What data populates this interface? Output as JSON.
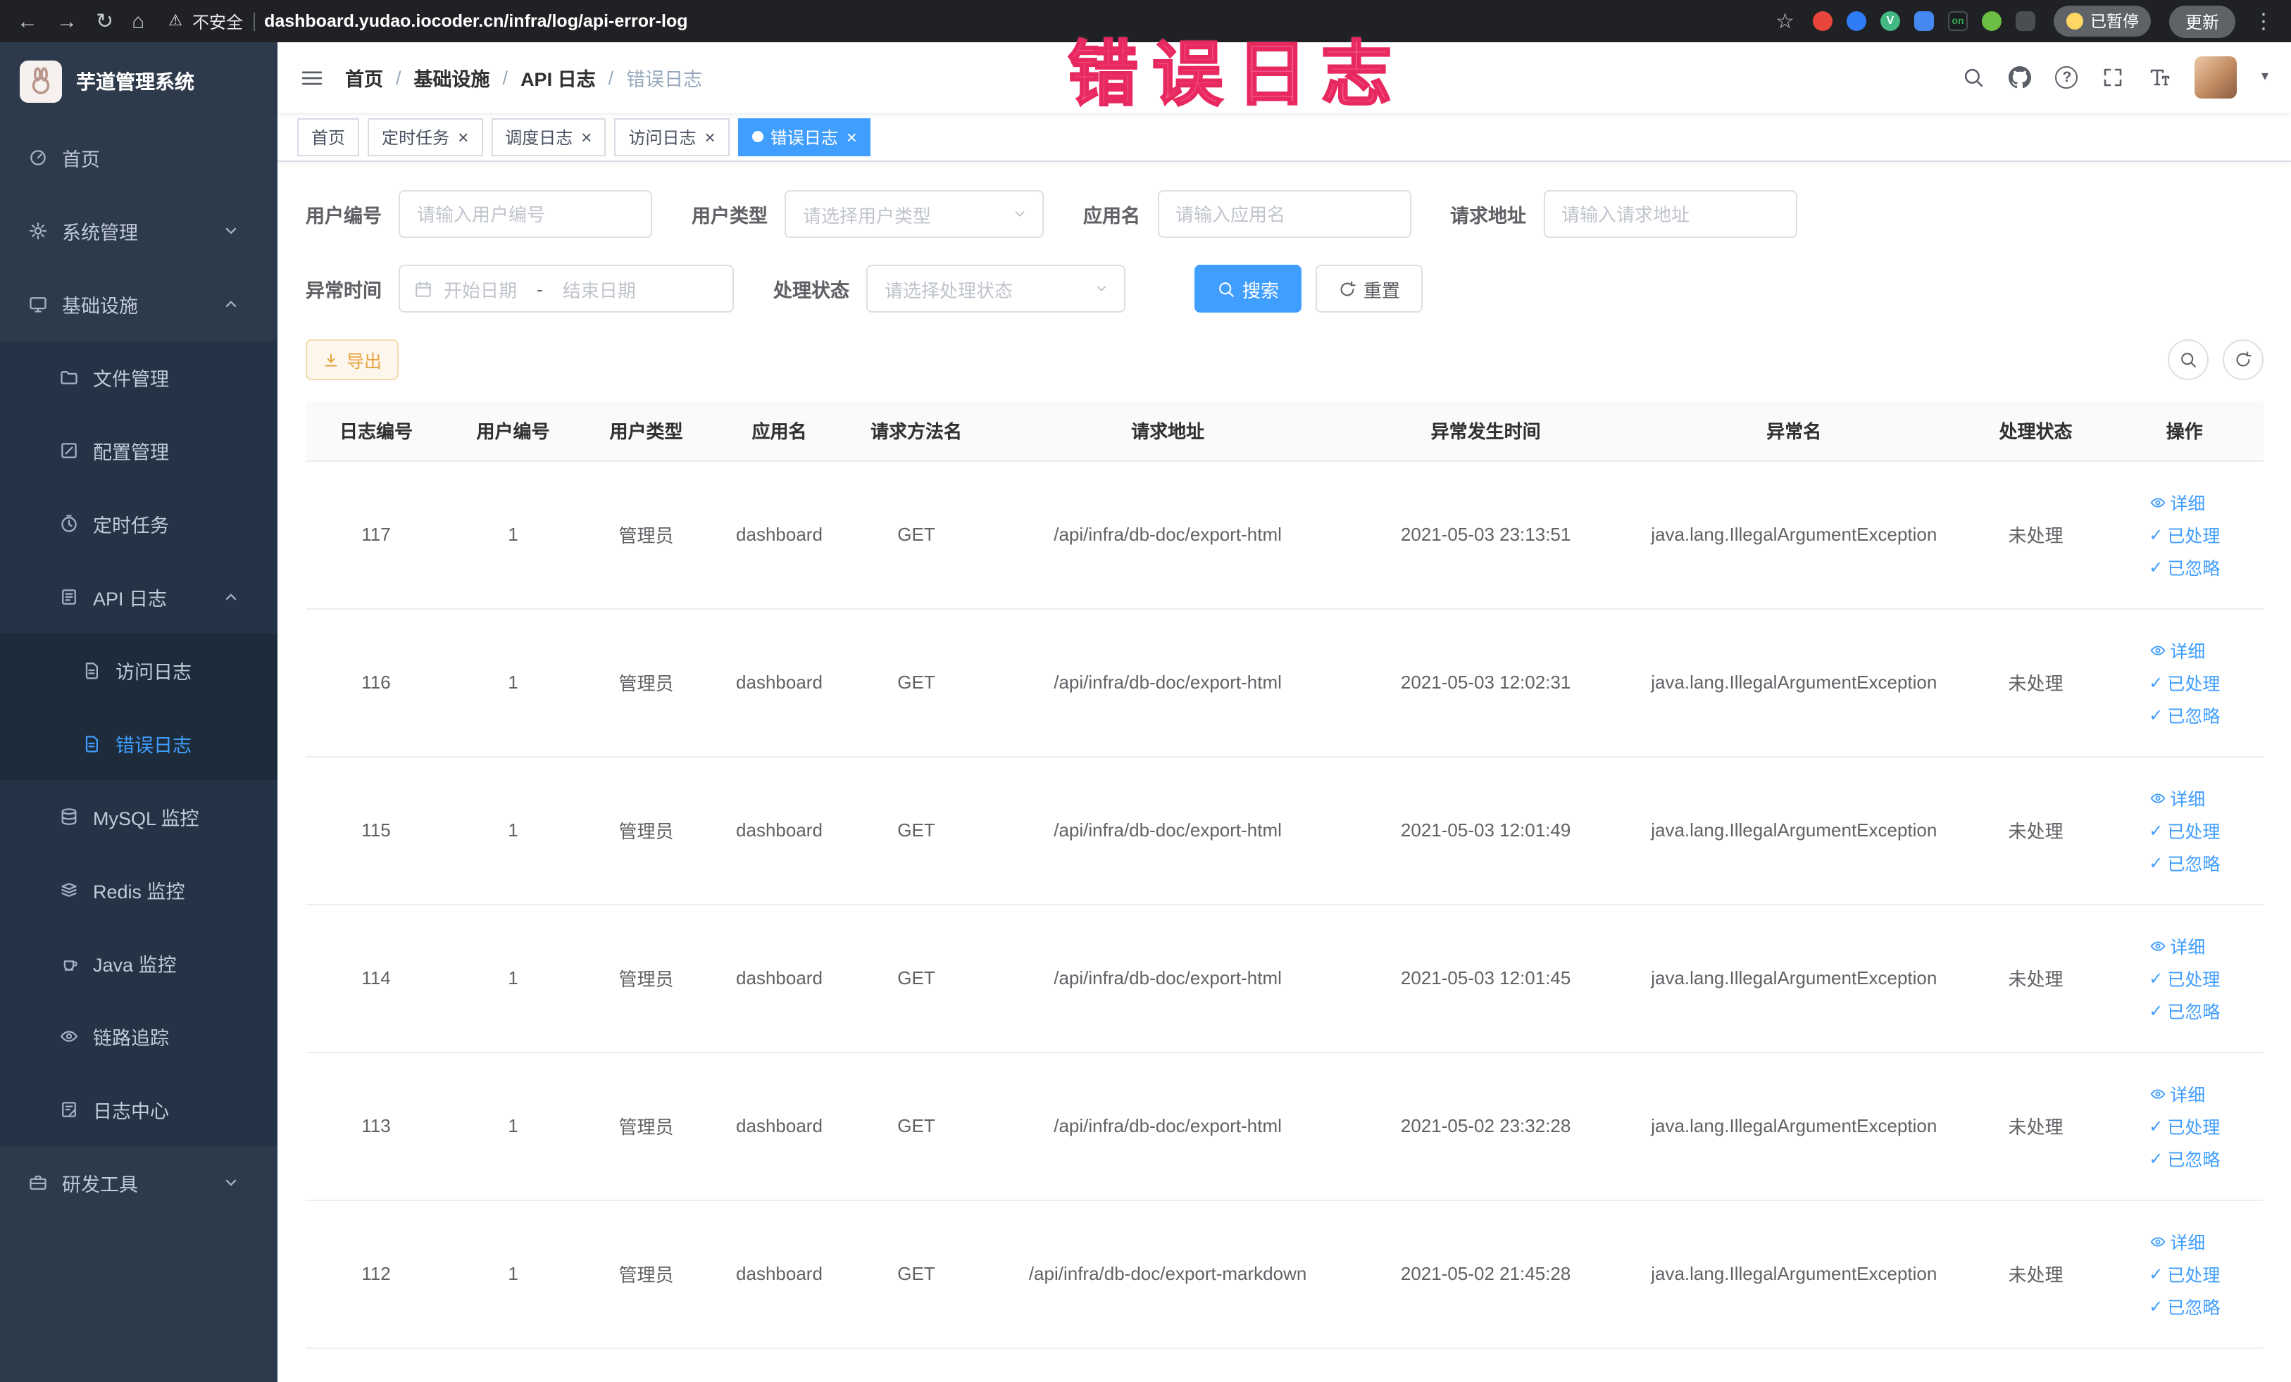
{
  "annotation": {
    "text": "错误日志",
    "color": "#f7598f",
    "stroke_color": "#e8295f"
  },
  "colors": {
    "primary": "#409eff",
    "warning": "#e6a23c",
    "sidebar_bg": "#2d3a4b"
  },
  "browser": {
    "security_label": "不安全",
    "url": "dashboard.yudao.iocoder.cn/infra/log/api-error-log",
    "paused_badge": "已暂停",
    "update_button": "更新"
  },
  "icons": {
    "back-icon": "←",
    "forward-icon": "→",
    "reload-icon": "↻",
    "home-icon": "⌂",
    "warning-icon": "⚠",
    "star-icon": "☆",
    "more-icon": "⋮",
    "caret-down-icon": "▾",
    "close-icon": "×",
    "check-icon": "✓",
    "question-icon": "?",
    "vue-icon": "V",
    "on-icon": "on"
  },
  "sidebar": {
    "logo_title": "芋道管理系统",
    "menu": [
      {
        "key": "home",
        "label": "首页",
        "icon": "dashboard-icon",
        "level": 0
      },
      {
        "key": "system",
        "label": "系统管理",
        "icon": "gear-icon",
        "level": 0,
        "arrow": "down"
      },
      {
        "key": "infra",
        "label": "基础设施",
        "icon": "monitor-icon",
        "level": 0,
        "arrow": "up"
      },
      {
        "key": "file",
        "label": "文件管理",
        "icon": "folder-icon",
        "level": 1
      },
      {
        "key": "config",
        "label": "配置管理",
        "icon": "edit-icon",
        "level": 1
      },
      {
        "key": "job",
        "label": "定时任务",
        "icon": "timer-icon",
        "level": 1
      },
      {
        "key": "api-log",
        "label": "API 日志",
        "icon": "api-log-icon",
        "level": 1,
        "arrow": "up"
      },
      {
        "key": "access-log",
        "label": "访问日志",
        "icon": "doc-icon",
        "level": 2
      },
      {
        "key": "error-log",
        "label": "错误日志",
        "icon": "doc-icon",
        "level": 2,
        "active": true
      },
      {
        "key": "mysql",
        "label": "MySQL 监控",
        "icon": "database-icon",
        "level": 1
      },
      {
        "key": "redis",
        "label": "Redis 监控",
        "icon": "redis-icon",
        "level": 1
      },
      {
        "key": "java",
        "label": "Java 监控",
        "icon": "java-icon",
        "level": 1
      },
      {
        "key": "trace",
        "label": "链路追踪",
        "icon": "eye-icon",
        "level": 1
      },
      {
        "key": "log-center",
        "label": "日志中心",
        "icon": "log-center-icon",
        "level": 1
      },
      {
        "key": "dev-tools",
        "label": "研发工具",
        "icon": "tool-icon",
        "level": 0,
        "arrow": "down"
      }
    ]
  },
  "navbar": {
    "breadcrumb": [
      "首页",
      "基础设施",
      "API 日志",
      "错误日志"
    ],
    "separator": "/"
  },
  "tabs": [
    {
      "key": "home",
      "label": "首页",
      "closable": false,
      "active": false
    },
    {
      "key": "job",
      "label": "定时任务",
      "closable": true,
      "active": false
    },
    {
      "key": "job-log",
      "label": "调度日志",
      "closable": true,
      "active": false
    },
    {
      "key": "access-log",
      "label": "访问日志",
      "closable": true,
      "active": false
    },
    {
      "key": "error-log",
      "label": "错误日志",
      "closable": true,
      "active": true
    }
  ],
  "filters": {
    "user_id": {
      "label": "用户编号",
      "placeholder": "请输入用户编号"
    },
    "user_type": {
      "label": "用户类型",
      "placeholder": "请选择用户类型"
    },
    "app_name": {
      "label": "应用名",
      "placeholder": "请输入应用名"
    },
    "request_url": {
      "label": "请求地址",
      "placeholder": "请输入请求地址"
    },
    "exception_time": {
      "label": "异常时间",
      "start_placeholder": "开始日期",
      "separator": "-",
      "end_placeholder": "结束日期"
    },
    "process_status": {
      "label": "处理状态",
      "placeholder": "请选择处理状态"
    },
    "search_button": "搜索",
    "reset_button": "重置"
  },
  "toolbar": {
    "export_button": "导出"
  },
  "table": {
    "columns": [
      "日志编号",
      "用户编号",
      "用户类型",
      "应用名",
      "请求方法名",
      "请求地址",
      "异常发生时间",
      "异常名",
      "处理状态",
      "操作"
    ],
    "actions": [
      "详细",
      "已处理",
      "已忽略"
    ],
    "rows": [
      {
        "log_id": "117",
        "user_id": "1",
        "user_type": "管理员",
        "app_name": "dashboard",
        "method": "GET",
        "url": "/api/infra/db-doc/export-html",
        "time": "2021-05-03 23:13:51",
        "exception": "java.lang.IllegalArgumentException",
        "status": "未处理"
      },
      {
        "log_id": "116",
        "user_id": "1",
        "user_type": "管理员",
        "app_name": "dashboard",
        "method": "GET",
        "url": "/api/infra/db-doc/export-html",
        "time": "2021-05-03 12:02:31",
        "exception": "java.lang.IllegalArgumentException",
        "status": "未处理"
      },
      {
        "log_id": "115",
        "user_id": "1",
        "user_type": "管理员",
        "app_name": "dashboard",
        "method": "GET",
        "url": "/api/infra/db-doc/export-html",
        "time": "2021-05-03 12:01:49",
        "exception": "java.lang.IllegalArgumentException",
        "status": "未处理"
      },
      {
        "log_id": "114",
        "user_id": "1",
        "user_type": "管理员",
        "app_name": "dashboard",
        "method": "GET",
        "url": "/api/infra/db-doc/export-html",
        "time": "2021-05-03 12:01:45",
        "exception": "java.lang.IllegalArgumentException",
        "status": "未处理"
      },
      {
        "log_id": "113",
        "user_id": "1",
        "user_type": "管理员",
        "app_name": "dashboard",
        "method": "GET",
        "url": "/api/infra/db-doc/export-html",
        "time": "2021-05-02 23:32:28",
        "exception": "java.lang.IllegalArgumentException",
        "status": "未处理"
      },
      {
        "log_id": "112",
        "user_id": "1",
        "user_type": "管理员",
        "app_name": "dashboard",
        "method": "GET",
        "url": "/api/infra/db-doc/export-markdown",
        "time": "2021-05-02 21:45:28",
        "exception": "java.lang.IllegalArgumentException",
        "status": "未处理"
      }
    ]
  }
}
